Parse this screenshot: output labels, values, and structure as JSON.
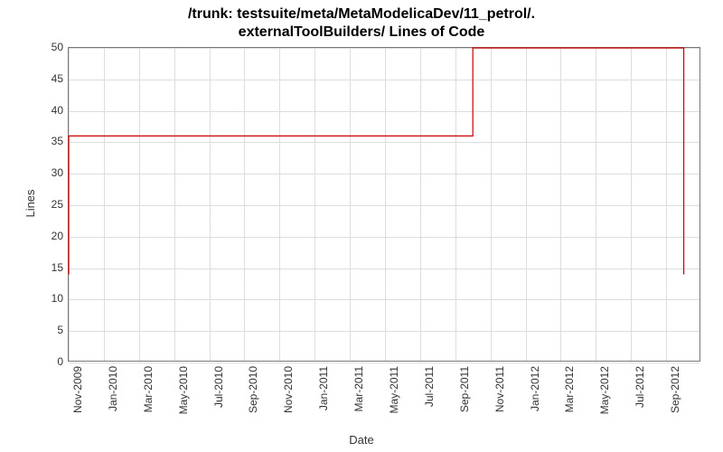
{
  "chart_data": {
    "type": "line",
    "title": "/trunk: testsuite/meta/MetaModelicaDev/11_petrol/.externalToolBuilders/ Lines of Code",
    "title_line1": "/trunk: testsuite/meta/MetaModelicaDev/11_petrol/.",
    "title_line2": "externalToolBuilders/ Lines of Code",
    "xlabel": "Date",
    "ylabel": "Lines",
    "ylim": [
      0,
      50
    ],
    "yticks": [
      0,
      5,
      10,
      15,
      20,
      25,
      30,
      35,
      40,
      45,
      50
    ],
    "x_tick_labels": [
      "Nov-2009",
      "Jan-2010",
      "Mar-2010",
      "May-2010",
      "Jul-2010",
      "Sep-2010",
      "Nov-2010",
      "Jan-2011",
      "Mar-2011",
      "May-2011",
      "Jul-2011",
      "Sep-2011",
      "Nov-2011",
      "Jan-2012",
      "Mar-2012",
      "May-2012",
      "Jul-2012",
      "Sep-2012"
    ],
    "x_range_months": 36,
    "series": [
      {
        "name": "lines-of-code",
        "points": [
          {
            "x_month": 0,
            "y": 14
          },
          {
            "x_month": 0,
            "y": 36
          },
          {
            "x_month": 23,
            "y": 36
          },
          {
            "x_month": 23,
            "y": 50
          },
          {
            "x_month": 35,
            "y": 50
          },
          {
            "x_month": 35,
            "y": 14
          }
        ]
      }
    ]
  }
}
